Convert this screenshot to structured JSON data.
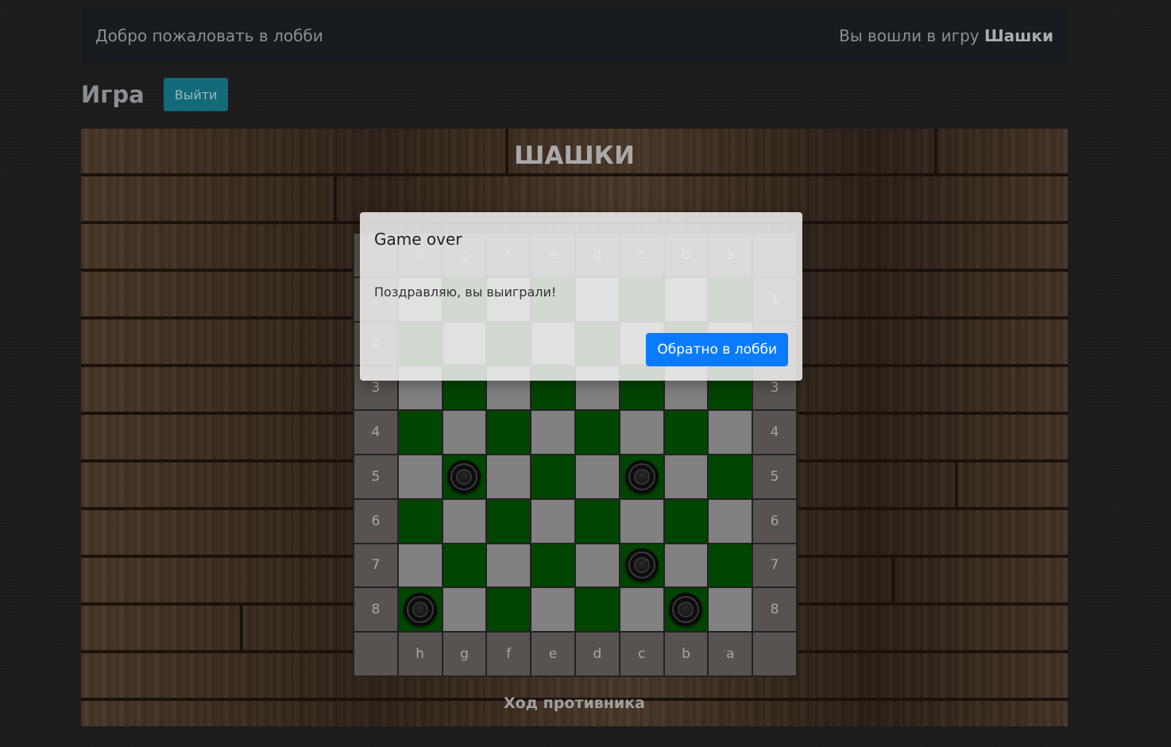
{
  "navbar": {
    "welcome": "Добро пожаловать в лобби",
    "entered_prefix": "Вы вошли в игру",
    "game_name": "Шашки"
  },
  "page": {
    "title": "Игра",
    "exit_label": "Выйти"
  },
  "board": {
    "title": "ШАШКИ",
    "files": [
      "h",
      "g",
      "f",
      "e",
      "d",
      "c",
      "b",
      "a"
    ],
    "ranks": [
      "1",
      "2",
      "3",
      "4",
      "5",
      "6",
      "7",
      "8"
    ],
    "pieces": [
      {
        "rank": 5,
        "file": "g",
        "color": "black"
      },
      {
        "rank": 5,
        "file": "c",
        "color": "black"
      },
      {
        "rank": 7,
        "file": "c",
        "color": "black"
      },
      {
        "rank": 8,
        "file": "h",
        "color": "black"
      },
      {
        "rank": 8,
        "file": "b",
        "color": "black"
      }
    ],
    "status": "Ход противника"
  },
  "modal": {
    "title": "Game over",
    "message": "Поздравляю, вы выиграли!",
    "button_label": "Обратно в лобби"
  },
  "colors": {
    "dark_square": "#004500",
    "light_square": "#818181",
    "edge": "#585250",
    "primary_button": "#0a7bff",
    "exit_button": "#136a78"
  }
}
